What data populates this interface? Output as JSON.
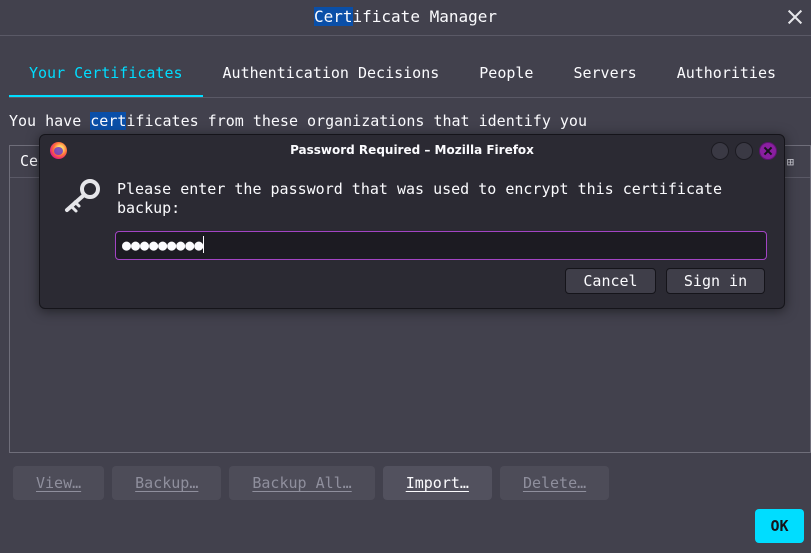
{
  "window": {
    "title_highlight": "Cert",
    "title_rest": "ificate Manager"
  },
  "tabs": [
    {
      "label": "Your Certificates",
      "active": true
    },
    {
      "label": "Authentication Decisions",
      "active": false
    },
    {
      "label": "People",
      "active": false
    },
    {
      "label": "Servers",
      "active": false
    },
    {
      "label": "Authorities",
      "active": false
    }
  ],
  "intro": {
    "before": "You have ",
    "highlight": "cert",
    "after": "ificates from these organizations that identify you"
  },
  "list": {
    "header_partial": "Ce"
  },
  "buttons": {
    "view": "View…",
    "backup": "Backup…",
    "backup_all": "Backup All…",
    "import": "Import…",
    "delete": "Delete…",
    "ok": "OK"
  },
  "dialog": {
    "title": "Password Required – Mozilla Firefox",
    "message": "Please enter the password that was used to encrypt this certificate backup:",
    "password_mask": "●●●●●●●●●",
    "cancel": "Cancel",
    "sign_in": "Sign in"
  },
  "colors": {
    "accent": "#00ddff",
    "focus_border": "#a244c4",
    "background": "#42414d",
    "dialog_bg": "#2b2a33"
  }
}
